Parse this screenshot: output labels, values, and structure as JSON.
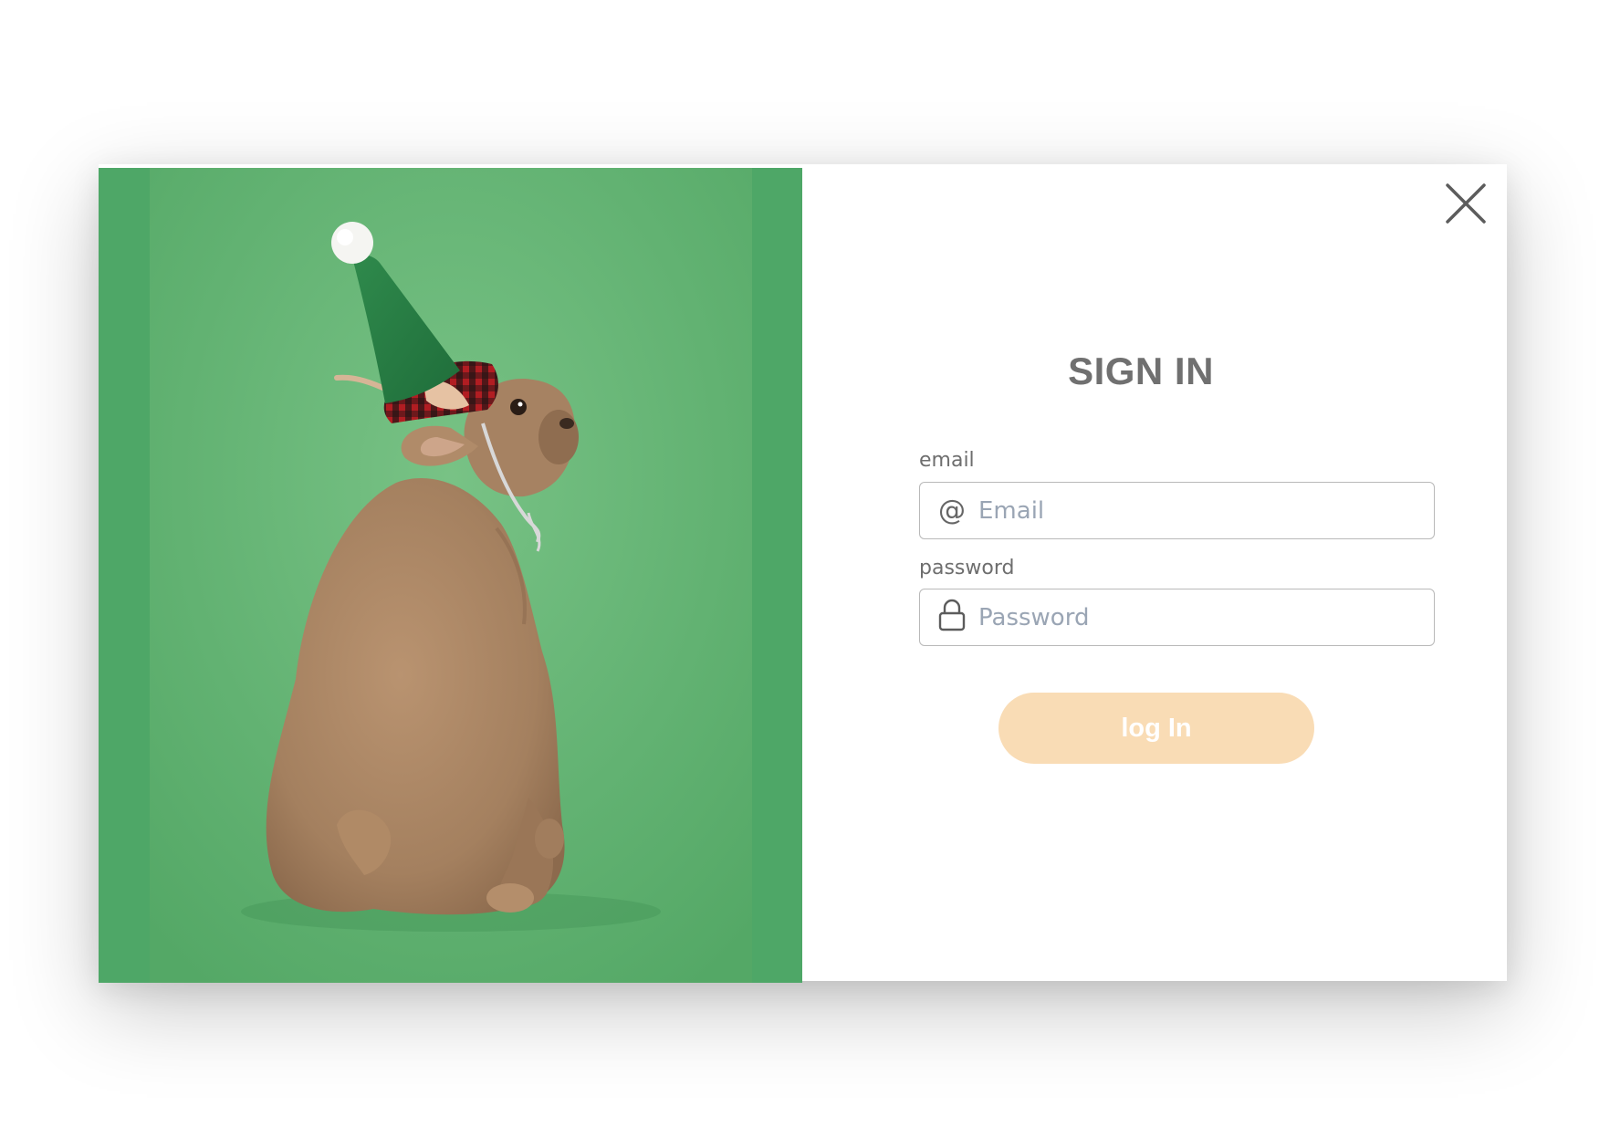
{
  "modal": {
    "title": "SIGN IN",
    "close_icon": "close-icon",
    "colors": {
      "image_backdrop": "#4ea767",
      "button_bg": "#f9dcb5",
      "button_text": "#ffffff",
      "title_text": "#707070"
    }
  },
  "photo": {
    "alt": "Dog wearing a green elf hat"
  },
  "form": {
    "email": {
      "label": "email",
      "placeholder": "Email",
      "value": "",
      "icon": "at-icon",
      "icon_glyph": "@"
    },
    "password": {
      "label": "password",
      "placeholder": "Password",
      "value": "",
      "icon": "lock-icon"
    },
    "submit_label": "log In"
  }
}
